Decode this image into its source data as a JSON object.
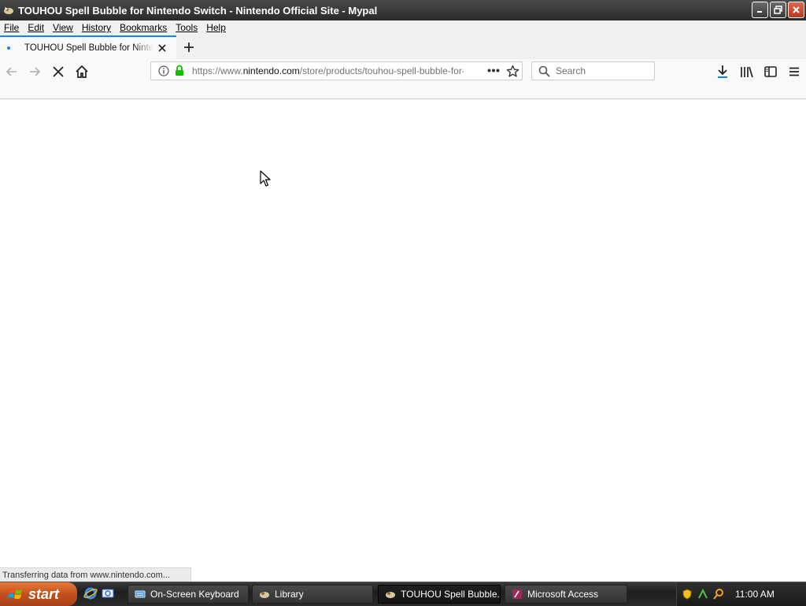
{
  "window": {
    "title": "TOUHOU Spell Bubble for Nintendo Switch - Nintendo Official Site - Mypal"
  },
  "menubar": {
    "items": [
      {
        "label": "File"
      },
      {
        "label": "Edit"
      },
      {
        "label": "View"
      },
      {
        "label": "History"
      },
      {
        "label": "Bookmarks"
      },
      {
        "label": "Tools"
      },
      {
        "label": "Help"
      }
    ]
  },
  "tabs": [
    {
      "title": "TOUHOU Spell Bubble for Nintendo Switch - Nintendo Official Site",
      "loading": true
    }
  ],
  "navbar": {
    "url_prefix": "https://www.",
    "url_host": "nintendo.com",
    "url_path": "/store/products/touhou-spell-bubble-for-switch/",
    "search_placeholder": "Search"
  },
  "status": {
    "text": "Transferring data from www.nintendo.com..."
  },
  "taskbar": {
    "start_label": "start",
    "tasks": [
      {
        "label": "On-Screen Keyboard",
        "active": false
      },
      {
        "label": "Library",
        "active": false
      },
      {
        "label": "TOUHOU Spell Bubble...",
        "active": true
      },
      {
        "label": "Microsoft Access",
        "active": false
      }
    ],
    "clock": "11:00 AM"
  },
  "colors": {
    "accent": "#0a84ff",
    "secure": "#12bc00",
    "titlebar": "#3a3a3a",
    "start_button": "#c2501c"
  }
}
